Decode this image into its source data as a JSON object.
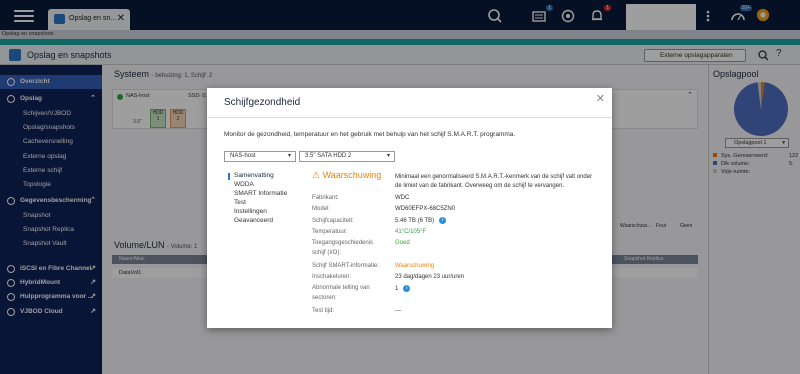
{
  "topbar": {
    "tab_label": "Opslag en sn...",
    "badges": {
      "tasks": "1",
      "alerts": "1",
      "events": "10+"
    }
  },
  "appbar": {
    "label": "Opslag en snapshots"
  },
  "header": {
    "title": "Opslag en snapshots",
    "external_storage": "Externe opslagapparaten"
  },
  "sidebar": {
    "items": [
      {
        "label": "Overzicht",
        "type": "active"
      },
      {
        "label": "Opslag",
        "type": "section"
      },
      {
        "label": "Schijven/VJBOD",
        "type": "sub"
      },
      {
        "label": "Opslag/snapshots",
        "type": "sub"
      },
      {
        "label": "Cacheversnelling",
        "type": "sub"
      },
      {
        "label": "Externe opslag",
        "type": "sub"
      },
      {
        "label": "Externe schijf",
        "type": "sub"
      },
      {
        "label": "Topologie",
        "type": "sub"
      },
      {
        "label": "Gegevensbescherming",
        "type": "section"
      },
      {
        "label": "Snapshot",
        "type": "sub"
      },
      {
        "label": "Snapshot Replica",
        "type": "sub"
      },
      {
        "label": "Snapshot Vault",
        "type": "sub"
      },
      {
        "label": "iSCSI en Fibre Channel",
        "type": "section"
      },
      {
        "label": "HybridMount",
        "type": "section"
      },
      {
        "label": "Hulpprogramma voor ...",
        "type": "section"
      },
      {
        "label": "VJBOD Cloud",
        "type": "section"
      }
    ]
  },
  "main": {
    "systeem_title": "Systeem",
    "systeem_sub": "- behuizing: 1, Schijf: 2",
    "nas_host": "NAS-host",
    "nas_disks": "SSD: 0, HDD: 2",
    "bay_label": "3.5\"",
    "hdd1": "HDD 1",
    "hdd2": "HDD 2",
    "legend_warn": "Waarschuwi...",
    "legend_fout": "Fout",
    "legend_geen": "Geen",
    "volume_title": "Volume/LUN",
    "volume_sub": "- Volume: 1",
    "table_col1": "Naam/Alias",
    "table_col2": "Snapshot Replica",
    "row1": "DataVol1"
  },
  "right": {
    "title": "Opslagpool",
    "pool_select": "Opslagpool 1",
    "legend": [
      {
        "label": "Sys. Gereserveerd:",
        "value": "122",
        "color": "#e8860b"
      },
      {
        "label": "Dik volume:",
        "value": "5.",
        "color": "#4f6fc0"
      },
      {
        "label": "Vrije ruimte:",
        "value": "",
        "color": "#d0d0d0"
      }
    ],
    "pie": {
      "reserved": 2.2,
      "thick_volume": 95.8,
      "free": 2.0
    }
  },
  "dialog": {
    "title": "Schijfgezondheid",
    "description": "Monitor de gezondheid, temperatuur en het gebruik met behulp van het schijf S.M.A.R.T. programma.",
    "host_select": "NAS-host",
    "disk_select": "3.5\" SATA HDD 2",
    "nav": [
      "Samenvatting",
      "WDDA",
      "SMART Informatie",
      "Test",
      "Instellingen",
      "Geavanceerd"
    ],
    "status_title": "Waarschuwing",
    "status_text": "Minimaal een genormaliseerd S.M.A.R.T.-kenmerk van de schijf valt onder de limiet van de fabrikant. Overweeg om de schijf te vervangen.",
    "fields": {
      "fabrikant_label": "Fabrikant:",
      "fabrikant": "WDC",
      "model_label": "Model:",
      "model": "WD60EFPX-68C5ZN0",
      "capaciteit_label": "Schijfcapaciteit:",
      "capaciteit": "5.46 TB (6 TB)",
      "temp_label": "Temperatuur:",
      "temp": "41°C/105°F",
      "toegang_label1": "Toegangsgeschiedenis",
      "toegang_label2": "schijf (I/O):",
      "toegang": "Goed",
      "smart_label": "Schijf SMART-informatie:",
      "smart": "Waarschuwing",
      "inschakel_label": "Inschakeluren:",
      "inschakel": "23 dag/dagen 23 uur/uren",
      "abnormaal_label1": "Abnormale telling van",
      "abnormaal_label2": "sectoren:",
      "abnormaal": "1",
      "test_label": "Test tijd:",
      "test": "---"
    }
  }
}
